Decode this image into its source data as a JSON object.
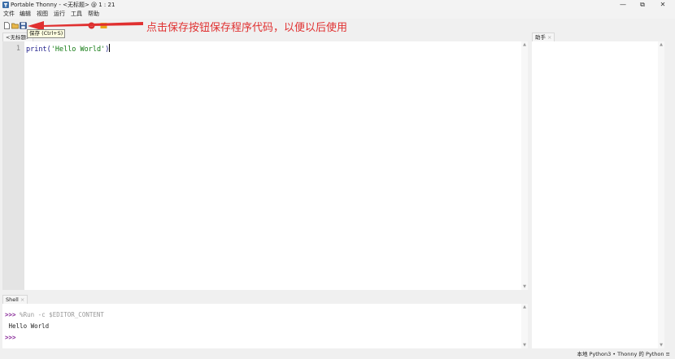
{
  "window": {
    "title": "Portable Thonny  -  <无标题>  @  1 : 21",
    "minimize_glyph": "—",
    "maximize_glyph": "⧉",
    "close_glyph": "✕"
  },
  "menu": {
    "items": [
      {
        "label": "文件"
      },
      {
        "label": "编辑"
      },
      {
        "label": "视图"
      },
      {
        "label": "运行"
      },
      {
        "label": "工具"
      },
      {
        "label": "帮助"
      }
    ]
  },
  "toolbar": {
    "tooltip": "保存 (Ctrl+S)",
    "buttons": [
      {
        "icon": "new-file-icon"
      },
      {
        "icon": "open-folder-icon"
      },
      {
        "icon": "save-icon"
      },
      {
        "icon": "stop-icon"
      },
      {
        "icon": "quit-icon"
      }
    ]
  },
  "annotation": {
    "text": "点击保存按钮保存程序代码，以便以后使用",
    "color": "#e03030"
  },
  "editor": {
    "tab_label": "<无标题>",
    "line_number": "1",
    "code_func": "print(",
    "code_string": "'Hello World'",
    "code_close": ")"
  },
  "assistant": {
    "tab_label": "助手",
    "close_glyph": "×"
  },
  "shell": {
    "tab_label": "Shell",
    "close_glyph": "×",
    "prompt": ">>>",
    "command": " %Run -c $EDITOR_CONTENT",
    "output": " Hello World",
    "prompt2": ">>>"
  },
  "status": {
    "text": "本地 Python3  •  Thonny 的 Python  ≡"
  },
  "colors": {
    "accent_red": "#e03030",
    "prompt_purple": "#8a2c9a",
    "string_green": "#117a11"
  }
}
